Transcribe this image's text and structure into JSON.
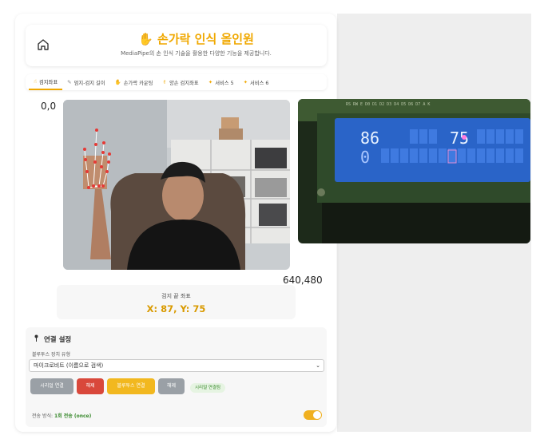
{
  "header": {
    "home_icon": "home-icon",
    "title_icon": "hand-icon",
    "title": "손가락 인식 올인원",
    "subtitle": "MediaPipe의 손 인식 기술을 활용한 다양한 기능을 제공합니다."
  },
  "tabs": [
    {
      "label": "검지좌표",
      "icon": "pointing-hand-icon",
      "active": true
    },
    {
      "label": "엄지-검지 길이",
      "icon": "pencil-icon"
    },
    {
      "label": "손가락 카운팅",
      "icon": "hand-icon"
    },
    {
      "label": "양손 검지좌표",
      "icon": "victory-hand-icon"
    },
    {
      "label": "서비스 5",
      "icon": "sparkle-icon"
    },
    {
      "label": "서비스 6",
      "icon": "sparkle-icon"
    }
  ],
  "camera": {
    "origin_label": "0,0",
    "extent_label": "640,480"
  },
  "lcd": {
    "row1_left": "86",
    "row1_right": "75",
    "row2_left": "0",
    "header_text": "RS RW E D0 D1 D2 D3 D4 D5 D6 D7 A K"
  },
  "coordinates": {
    "label": "검지 끝 좌표",
    "value": "X: 87, Y: 75"
  },
  "connection": {
    "title": "연결 설정",
    "title_icon": "pin-icon",
    "device_type_label": "블루투스 장치 유형",
    "device_type_value": "마이크로비트 (이름으로 검색)",
    "buttons": {
      "serial_connect": "시리얼 연결",
      "serial_disconnect": "해제",
      "bluetooth_connect": "블루투스 연결",
      "bluetooth_disconnect": "해제"
    },
    "status": "시리얼 연결됨",
    "mode_label": "전송 방식:",
    "mode_value": "1회 전송 (once)",
    "toggle_on": true
  },
  "colors": {
    "accent": "#f0a800",
    "danger": "#d9483b",
    "neutral": "#9aa0a6",
    "success": "#3a8a2e"
  }
}
